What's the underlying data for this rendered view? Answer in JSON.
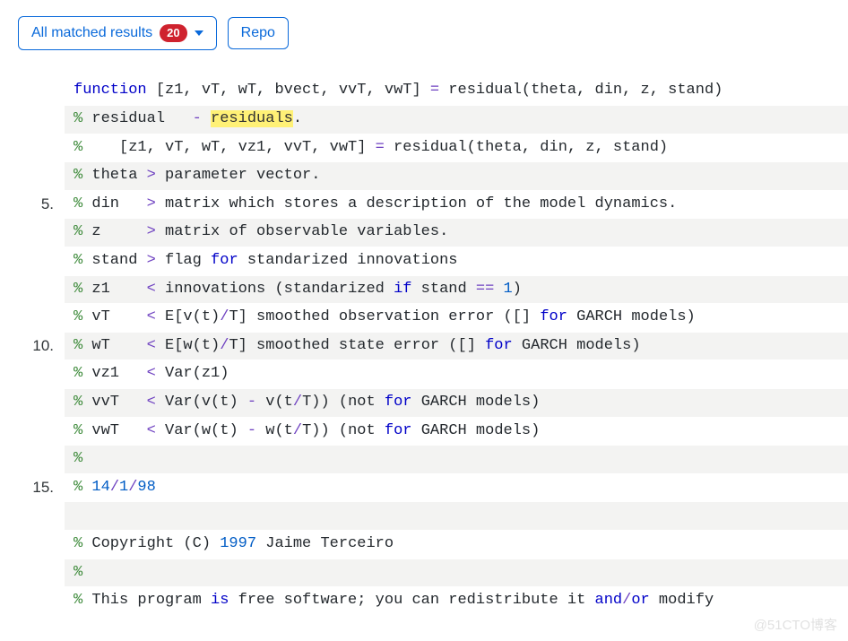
{
  "toolbar": {
    "matched_label": "All matched results",
    "matched_count": "20",
    "repo_label": "Repo"
  },
  "code": {
    "lines": [
      {
        "n": "",
        "parts": [
          {
            "t": "function",
            "c": "c-kw"
          },
          {
            "t": " [z1, vT, wT, bvect, vvT, vwT] ",
            "c": "c-txt"
          },
          {
            "t": "=",
            "c": "c-op"
          },
          {
            "t": " residual(theta, din, z, stand)",
            "c": "c-txt"
          }
        ]
      },
      {
        "n": "",
        "parts": [
          {
            "t": "%",
            "c": "c-cm"
          },
          {
            "t": " residual   ",
            "c": "c-txt"
          },
          {
            "t": "-",
            "c": "c-op"
          },
          {
            "t": " ",
            "c": "c-txt"
          },
          {
            "t": "residuals",
            "c": "c-hl"
          },
          {
            "t": ".",
            "c": "c-txt"
          }
        ]
      },
      {
        "n": "",
        "parts": [
          {
            "t": "%",
            "c": "c-cm"
          },
          {
            "t": "    [z1, vT, wT, vz1, vvT, vwT] ",
            "c": "c-txt"
          },
          {
            "t": "=",
            "c": "c-op"
          },
          {
            "t": " residual(theta, din, z, stand)",
            "c": "c-txt"
          }
        ]
      },
      {
        "n": "",
        "parts": [
          {
            "t": "%",
            "c": "c-cm"
          },
          {
            "t": " theta ",
            "c": "c-txt"
          },
          {
            "t": ">",
            "c": "c-op"
          },
          {
            "t": " parameter vector.",
            "c": "c-txt"
          }
        ]
      },
      {
        "n": "5.",
        "parts": [
          {
            "t": "%",
            "c": "c-cm"
          },
          {
            "t": " din   ",
            "c": "c-txt"
          },
          {
            "t": ">",
            "c": "c-op"
          },
          {
            "t": " matrix which stores a description of the model dynamics.",
            "c": "c-txt"
          }
        ]
      },
      {
        "n": "",
        "parts": [
          {
            "t": "%",
            "c": "c-cm"
          },
          {
            "t": " z     ",
            "c": "c-txt"
          },
          {
            "t": ">",
            "c": "c-op"
          },
          {
            "t": " matrix of observable variables.",
            "c": "c-txt"
          }
        ]
      },
      {
        "n": "",
        "parts": [
          {
            "t": "%",
            "c": "c-cm"
          },
          {
            "t": " stand ",
            "c": "c-txt"
          },
          {
            "t": ">",
            "c": "c-op"
          },
          {
            "t": " flag ",
            "c": "c-txt"
          },
          {
            "t": "for",
            "c": "c-kw"
          },
          {
            "t": " standarized innovations",
            "c": "c-txt"
          }
        ]
      },
      {
        "n": "",
        "parts": [
          {
            "t": "%",
            "c": "c-cm"
          },
          {
            "t": " z1    ",
            "c": "c-txt"
          },
          {
            "t": "<",
            "c": "c-op"
          },
          {
            "t": " innovations (standarized ",
            "c": "c-txt"
          },
          {
            "t": "if",
            "c": "c-kw"
          },
          {
            "t": " stand ",
            "c": "c-txt"
          },
          {
            "t": "==",
            "c": "c-op"
          },
          {
            "t": " ",
            "c": "c-txt"
          },
          {
            "t": "1",
            "c": "c-num"
          },
          {
            "t": ")",
            "c": "c-txt"
          }
        ]
      },
      {
        "n": "",
        "parts": [
          {
            "t": "%",
            "c": "c-cm"
          },
          {
            "t": " vT    ",
            "c": "c-txt"
          },
          {
            "t": "<",
            "c": "c-op"
          },
          {
            "t": " E[v(t)",
            "c": "c-txt"
          },
          {
            "t": "/",
            "c": "c-op"
          },
          {
            "t": "T] smoothed observation error ([] ",
            "c": "c-txt"
          },
          {
            "t": "for",
            "c": "c-kw"
          },
          {
            "t": " GARCH models)",
            "c": "c-txt"
          }
        ]
      },
      {
        "n": "10.",
        "parts": [
          {
            "t": "%",
            "c": "c-cm"
          },
          {
            "t": " wT    ",
            "c": "c-txt"
          },
          {
            "t": "<",
            "c": "c-op"
          },
          {
            "t": " E[w(t)",
            "c": "c-txt"
          },
          {
            "t": "/",
            "c": "c-op"
          },
          {
            "t": "T] smoothed state error ([] ",
            "c": "c-txt"
          },
          {
            "t": "for",
            "c": "c-kw"
          },
          {
            "t": " GARCH models)",
            "c": "c-txt"
          }
        ]
      },
      {
        "n": "",
        "parts": [
          {
            "t": "%",
            "c": "c-cm"
          },
          {
            "t": " vz1   ",
            "c": "c-txt"
          },
          {
            "t": "<",
            "c": "c-op"
          },
          {
            "t": " Var(z1)",
            "c": "c-txt"
          }
        ]
      },
      {
        "n": "",
        "parts": [
          {
            "t": "%",
            "c": "c-cm"
          },
          {
            "t": " vvT   ",
            "c": "c-txt"
          },
          {
            "t": "<",
            "c": "c-op"
          },
          {
            "t": " Var(v(t) ",
            "c": "c-txt"
          },
          {
            "t": "-",
            "c": "c-op"
          },
          {
            "t": " v(t",
            "c": "c-txt"
          },
          {
            "t": "/",
            "c": "c-op"
          },
          {
            "t": "T)) (not ",
            "c": "c-txt"
          },
          {
            "t": "for",
            "c": "c-kw"
          },
          {
            "t": " GARCH models)",
            "c": "c-txt"
          }
        ]
      },
      {
        "n": "",
        "parts": [
          {
            "t": "%",
            "c": "c-cm"
          },
          {
            "t": " vwT   ",
            "c": "c-txt"
          },
          {
            "t": "<",
            "c": "c-op"
          },
          {
            "t": " Var(w(t) ",
            "c": "c-txt"
          },
          {
            "t": "-",
            "c": "c-op"
          },
          {
            "t": " w(t",
            "c": "c-txt"
          },
          {
            "t": "/",
            "c": "c-op"
          },
          {
            "t": "T)) (not ",
            "c": "c-txt"
          },
          {
            "t": "for",
            "c": "c-kw"
          },
          {
            "t": " GARCH models)",
            "c": "c-txt"
          }
        ]
      },
      {
        "n": "",
        "parts": [
          {
            "t": "%",
            "c": "c-cm"
          }
        ]
      },
      {
        "n": "15.",
        "parts": [
          {
            "t": "%",
            "c": "c-cm"
          },
          {
            "t": " ",
            "c": "c-txt"
          },
          {
            "t": "14",
            "c": "c-num"
          },
          {
            "t": "/",
            "c": "c-op"
          },
          {
            "t": "1",
            "c": "c-num"
          },
          {
            "t": "/",
            "c": "c-op"
          },
          {
            "t": "98",
            "c": "c-num"
          }
        ]
      },
      {
        "n": "",
        "parts": [
          {
            "t": " ",
            "c": "c-txt"
          }
        ]
      },
      {
        "n": "",
        "parts": [
          {
            "t": "%",
            "c": "c-cm"
          },
          {
            "t": " Copyright (C) ",
            "c": "c-txt"
          },
          {
            "t": "1997",
            "c": "c-num"
          },
          {
            "t": " Jaime Terceiro",
            "c": "c-txt"
          }
        ]
      },
      {
        "n": "",
        "parts": [
          {
            "t": "%",
            "c": "c-cm"
          }
        ]
      },
      {
        "n": "",
        "parts": [
          {
            "t": "%",
            "c": "c-cm"
          },
          {
            "t": " This program ",
            "c": "c-txt"
          },
          {
            "t": "is",
            "c": "c-kw"
          },
          {
            "t": " free software; you can redistribute it ",
            "c": "c-txt"
          },
          {
            "t": "and",
            "c": "c-kw"
          },
          {
            "t": "/",
            "c": "c-op"
          },
          {
            "t": "or",
            "c": "c-kw"
          },
          {
            "t": " modify",
            "c": "c-txt"
          }
        ]
      }
    ]
  },
  "watermark": "@51CTO博客"
}
